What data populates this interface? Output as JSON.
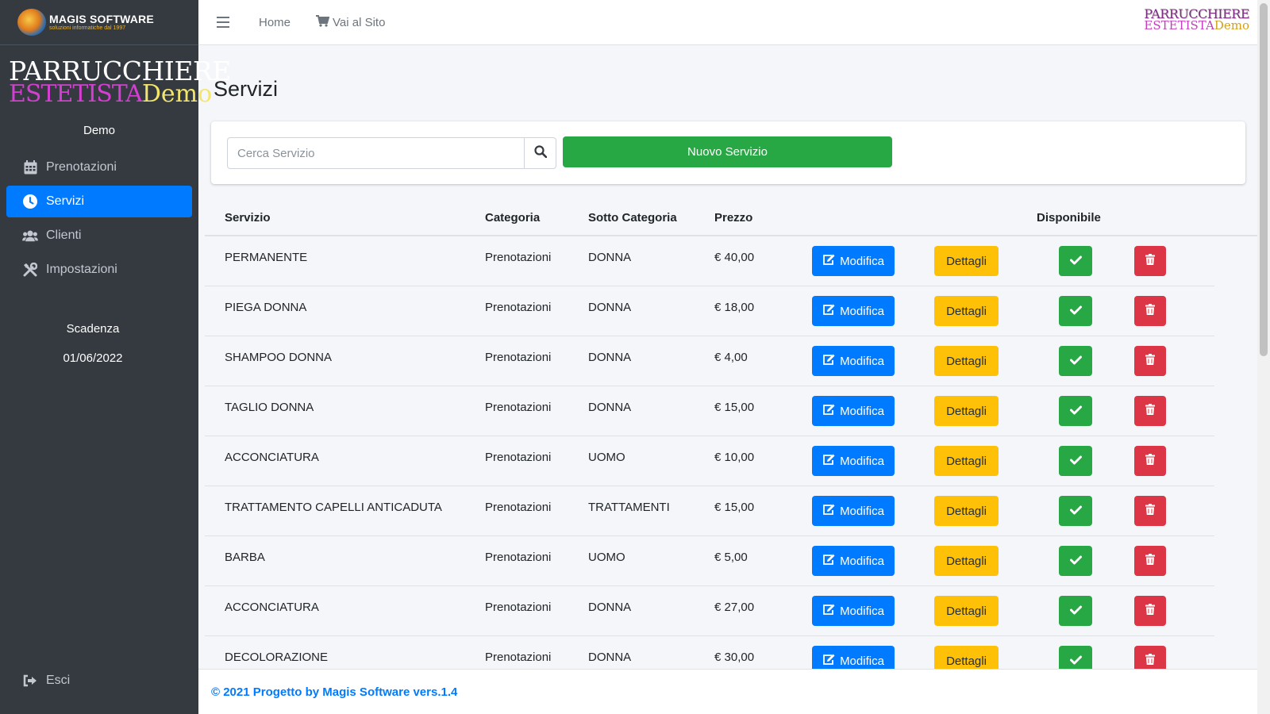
{
  "brand": {
    "title": "MAGIS SOFTWARE",
    "subtitle": "soluzioni informatiche dal 1997"
  },
  "logo": {
    "line1": "PARRUCCHIERE",
    "line2a": "ESTETISTA",
    "line2b": "Demo"
  },
  "user": {
    "name": "Demo"
  },
  "sidebar": {
    "items": [
      {
        "label": "Prenotazioni",
        "icon": "calendar-icon"
      },
      {
        "label": "Servizi",
        "icon": "clock-icon"
      },
      {
        "label": "Clienti",
        "icon": "users-icon"
      },
      {
        "label": "Impostazioni",
        "icon": "tools-icon"
      }
    ],
    "expiry_label": "Scadenza",
    "expiry_date": "01/06/2022",
    "logout_label": "Esci"
  },
  "topbar": {
    "home_label": "Home",
    "site_label": "Vai al Sito"
  },
  "page": {
    "title": "Servizi"
  },
  "search": {
    "placeholder": "Cerca Servizio",
    "new_button": "Nuovo Servizio"
  },
  "table": {
    "headers": {
      "service": "Servizio",
      "category": "Categoria",
      "subcategory": "Sotto Categoria",
      "price": "Prezzo",
      "available": "Disponibile"
    },
    "edit_label": "Modifica",
    "details_label": "Dettagli",
    "rows": [
      {
        "service": "PERMANENTE",
        "category": "Prenotazioni",
        "subcategory": "DONNA",
        "price": "€ 40,00"
      },
      {
        "service": "PIEGA DONNA",
        "category": "Prenotazioni",
        "subcategory": "DONNA",
        "price": "€ 18,00"
      },
      {
        "service": "SHAMPOO DONNA",
        "category": "Prenotazioni",
        "subcategory": "DONNA",
        "price": "€ 4,00"
      },
      {
        "service": "TAGLIO DONNA",
        "category": "Prenotazioni",
        "subcategory": "DONNA",
        "price": "€ 15,00"
      },
      {
        "service": "ACCONCIATURA",
        "category": "Prenotazioni",
        "subcategory": "UOMO",
        "price": "€ 10,00"
      },
      {
        "service": "TRATTAMENTO CAPELLI ANTICADUTA",
        "category": "Prenotazioni",
        "subcategory": "TRATTAMENTI",
        "price": "€ 15,00"
      },
      {
        "service": "BARBA",
        "category": "Prenotazioni",
        "subcategory": "UOMO",
        "price": "€ 5,00"
      },
      {
        "service": "ACCONCIATURA",
        "category": "Prenotazioni",
        "subcategory": "DONNA",
        "price": "€ 27,00"
      },
      {
        "service": "DECOLORAZIONE",
        "category": "Prenotazioni",
        "subcategory": "DONNA",
        "price": "€ 30,00"
      }
    ]
  },
  "footer": {
    "text": "© 2021 Progetto by Magis Software vers.1.4"
  },
  "colors": {
    "sidebar": "#343a40",
    "primary": "#007bff",
    "success": "#28a745",
    "warning": "#ffc107",
    "danger": "#dc3545"
  }
}
